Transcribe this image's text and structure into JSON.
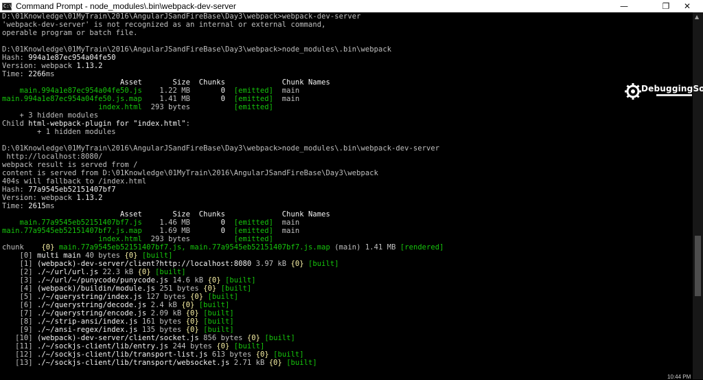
{
  "window": {
    "title": "Command Prompt - node_modules\\.bin\\webpack-dev-server",
    "icon_label": "C:\\",
    "controls": {
      "minimize": "—",
      "maximize": "❐",
      "close": "✕"
    }
  },
  "colors": {
    "background": "#000000",
    "text": "#c0c0c0",
    "green": "#16c60c",
    "yellow": "#f9f1a5",
    "white": "#f2f2f2"
  },
  "console": {
    "lines": [
      [
        {
          "t": "D:\\01Knowledge\\01MyTrain\\2016\\AngularJSandFireBase\\Day3\\webpack>webpack-dev-server",
          "c": ""
        }
      ],
      [
        {
          "t": "'webpack-dev-server' is not recognized as an internal or external command,",
          "c": ""
        }
      ],
      [
        {
          "t": "operable program or batch file.",
          "c": ""
        }
      ],
      [
        {
          "t": "",
          "c": ""
        }
      ],
      [
        {
          "t": "D:\\01Knowledge\\01MyTrain\\2016\\AngularJSandFireBase\\Day3\\webpack>node_modules\\.bin\\webpack",
          "c": ""
        }
      ],
      [
        {
          "t": "Hash: ",
          "c": ""
        },
        {
          "t": "994a1e87ec954a04fe50",
          "c": "w"
        }
      ],
      [
        {
          "t": "Version: webpack ",
          "c": ""
        },
        {
          "t": "1.13.2",
          "c": "w"
        }
      ],
      [
        {
          "t": "Time: ",
          "c": ""
        },
        {
          "t": "2266",
          "c": "w"
        },
        {
          "t": "ms",
          "c": ""
        }
      ],
      [
        {
          "t": "                           Asset       Size  Chunks             Chunk Names",
          "c": "w"
        }
      ],
      [
        {
          "t": "    main.994a1e87ec954a04fe50.js",
          "c": "g"
        },
        {
          "t": "    1.22 MB       ",
          "c": ""
        },
        {
          "t": "0",
          "c": "w"
        },
        {
          "t": "  ",
          "c": ""
        },
        {
          "t": "[emitted]",
          "c": "g"
        },
        {
          "t": "  main",
          "c": ""
        }
      ],
      [
        {
          "t": "main.994a1e87ec954a04fe50.js.map",
          "c": "g"
        },
        {
          "t": "    1.41 MB       ",
          "c": ""
        },
        {
          "t": "0",
          "c": "w"
        },
        {
          "t": "  ",
          "c": ""
        },
        {
          "t": "[emitted]",
          "c": "g"
        },
        {
          "t": "  main",
          "c": ""
        }
      ],
      [
        {
          "t": "                      index.html",
          "c": "g"
        },
        {
          "t": "  293 bytes          ",
          "c": ""
        },
        {
          "t": "[emitted]",
          "c": "g"
        }
      ],
      [
        {
          "t": "    + 3 hidden modules",
          "c": ""
        }
      ],
      [
        {
          "t": "Child ",
          "c": ""
        },
        {
          "t": "html-webpack-plugin for \"index.html\"",
          "c": "w"
        },
        {
          "t": ":",
          "c": ""
        }
      ],
      [
        {
          "t": "        + 1 hidden modules",
          "c": ""
        }
      ],
      [
        {
          "t": "",
          "c": ""
        }
      ],
      [
        {
          "t": "D:\\01Knowledge\\01MyTrain\\2016\\AngularJSandFireBase\\Day3\\webpack>node_modules\\.bin\\webpack-dev-server",
          "c": ""
        }
      ],
      [
        {
          "t": " http://localhost:8080/",
          "c": ""
        }
      ],
      [
        {
          "t": "webpack result is served from /",
          "c": ""
        }
      ],
      [
        {
          "t": "content is served from D:\\01Knowledge\\01MyTrain\\2016\\AngularJSandFireBase\\Day3\\webpack",
          "c": ""
        }
      ],
      [
        {
          "t": "404s will fallback to /index.html",
          "c": ""
        }
      ],
      [
        {
          "t": "Hash: ",
          "c": ""
        },
        {
          "t": "77a9545eb52151407bf7",
          "c": "w"
        }
      ],
      [
        {
          "t": "Version: webpack ",
          "c": ""
        },
        {
          "t": "1.13.2",
          "c": "w"
        }
      ],
      [
        {
          "t": "Time: ",
          "c": ""
        },
        {
          "t": "2615",
          "c": "w"
        },
        {
          "t": "ms",
          "c": ""
        }
      ],
      [
        {
          "t": "                           Asset       Size  Chunks             Chunk Names",
          "c": "w"
        }
      ],
      [
        {
          "t": "    main.77a9545eb52151407bf7.js",
          "c": "g"
        },
        {
          "t": "    1.46 MB       ",
          "c": ""
        },
        {
          "t": "0",
          "c": "w"
        },
        {
          "t": "  ",
          "c": ""
        },
        {
          "t": "[emitted]",
          "c": "g"
        },
        {
          "t": "  main",
          "c": ""
        }
      ],
      [
        {
          "t": "main.77a9545eb52151407bf7.js.map",
          "c": "g"
        },
        {
          "t": "    1.69 MB       ",
          "c": ""
        },
        {
          "t": "0",
          "c": "w"
        },
        {
          "t": "  ",
          "c": ""
        },
        {
          "t": "[emitted]",
          "c": "g"
        },
        {
          "t": "  main",
          "c": ""
        }
      ],
      [
        {
          "t": "                      index.html",
          "c": "g"
        },
        {
          "t": "  293 bytes          ",
          "c": ""
        },
        {
          "t": "[emitted]",
          "c": "g"
        }
      ],
      [
        {
          "t": "chunk    ",
          "c": ""
        },
        {
          "t": "{0}",
          "c": "y"
        },
        {
          "t": " main.77a9545eb52151407bf7.js, main.77a9545eb52151407bf7.js.map",
          "c": "g"
        },
        {
          "t": " (main) 1.41 MB ",
          "c": ""
        },
        {
          "t": "[rendered]",
          "c": "g"
        }
      ],
      [
        {
          "t": "    [0] ",
          "c": ""
        },
        {
          "t": "multi main",
          "c": "w"
        },
        {
          "t": " 40 bytes ",
          "c": ""
        },
        {
          "t": "{0}",
          "c": "y"
        },
        {
          "t": " ",
          "c": ""
        },
        {
          "t": "[built]",
          "c": "g"
        }
      ],
      [
        {
          "t": "    [1] ",
          "c": ""
        },
        {
          "t": "(webpack)-dev-server/client?http://localhost:8080",
          "c": "w"
        },
        {
          "t": " 3.97 kB ",
          "c": ""
        },
        {
          "t": "{0}",
          "c": "y"
        },
        {
          "t": " ",
          "c": ""
        },
        {
          "t": "[built]",
          "c": "g"
        }
      ],
      [
        {
          "t": "    [2] ",
          "c": ""
        },
        {
          "t": "./~/url/url.js",
          "c": "w"
        },
        {
          "t": " 22.3 kB ",
          "c": ""
        },
        {
          "t": "{0}",
          "c": "y"
        },
        {
          "t": " ",
          "c": ""
        },
        {
          "t": "[built]",
          "c": "g"
        }
      ],
      [
        {
          "t": "    [3] ",
          "c": ""
        },
        {
          "t": "./~/url/~/punycode/punycode.js",
          "c": "w"
        },
        {
          "t": " 14.6 kB ",
          "c": ""
        },
        {
          "t": "{0}",
          "c": "y"
        },
        {
          "t": " ",
          "c": ""
        },
        {
          "t": "[built]",
          "c": "g"
        }
      ],
      [
        {
          "t": "    [4] ",
          "c": ""
        },
        {
          "t": "(webpack)/buildin/module.js",
          "c": "w"
        },
        {
          "t": " 251 bytes ",
          "c": ""
        },
        {
          "t": "{0}",
          "c": "y"
        },
        {
          "t": " ",
          "c": ""
        },
        {
          "t": "[built]",
          "c": "g"
        }
      ],
      [
        {
          "t": "    [5] ",
          "c": ""
        },
        {
          "t": "./~/querystring/index.js",
          "c": "w"
        },
        {
          "t": " 127 bytes ",
          "c": ""
        },
        {
          "t": "{0}",
          "c": "y"
        },
        {
          "t": " ",
          "c": ""
        },
        {
          "t": "[built]",
          "c": "g"
        }
      ],
      [
        {
          "t": "    [6] ",
          "c": ""
        },
        {
          "t": "./~/querystring/decode.js",
          "c": "w"
        },
        {
          "t": " 2.4 kB ",
          "c": ""
        },
        {
          "t": "{0}",
          "c": "y"
        },
        {
          "t": " ",
          "c": ""
        },
        {
          "t": "[built]",
          "c": "g"
        }
      ],
      [
        {
          "t": "    [7] ",
          "c": ""
        },
        {
          "t": "./~/querystring/encode.js",
          "c": "w"
        },
        {
          "t": " 2.09 kB ",
          "c": ""
        },
        {
          "t": "{0}",
          "c": "y"
        },
        {
          "t": " ",
          "c": ""
        },
        {
          "t": "[built]",
          "c": "g"
        }
      ],
      [
        {
          "t": "    [8] ",
          "c": ""
        },
        {
          "t": "./~/strip-ansi/index.js",
          "c": "w"
        },
        {
          "t": " 161 bytes ",
          "c": ""
        },
        {
          "t": "{0}",
          "c": "y"
        },
        {
          "t": " ",
          "c": ""
        },
        {
          "t": "[built]",
          "c": "g"
        }
      ],
      [
        {
          "t": "    [9] ",
          "c": ""
        },
        {
          "t": "./~/ansi-regex/index.js",
          "c": "w"
        },
        {
          "t": " 135 bytes ",
          "c": ""
        },
        {
          "t": "{0}",
          "c": "y"
        },
        {
          "t": " ",
          "c": ""
        },
        {
          "t": "[built]",
          "c": "g"
        }
      ],
      [
        {
          "t": "   [10] ",
          "c": ""
        },
        {
          "t": "(webpack)-dev-server/client/socket.js",
          "c": "w"
        },
        {
          "t": " 856 bytes ",
          "c": ""
        },
        {
          "t": "{0}",
          "c": "y"
        },
        {
          "t": " ",
          "c": ""
        },
        {
          "t": "[built]",
          "c": "g"
        }
      ],
      [
        {
          "t": "   [11] ",
          "c": ""
        },
        {
          "t": "./~/sockjs-client/lib/entry.js",
          "c": "w"
        },
        {
          "t": " 244 bytes ",
          "c": ""
        },
        {
          "t": "{0}",
          "c": "y"
        },
        {
          "t": " ",
          "c": ""
        },
        {
          "t": "[built]",
          "c": "g"
        }
      ],
      [
        {
          "t": "   [12] ",
          "c": ""
        },
        {
          "t": "./~/sockjs-client/lib/transport-list.js",
          "c": "w"
        },
        {
          "t": " 613 bytes ",
          "c": ""
        },
        {
          "t": "{0}",
          "c": "y"
        },
        {
          "t": " ",
          "c": ""
        },
        {
          "t": "[built]",
          "c": "g"
        }
      ],
      [
        {
          "t": "   [13] ",
          "c": ""
        },
        {
          "t": "./~/sockjs-client/lib/transport/websocket.js",
          "c": "w"
        },
        {
          "t": " 2.71 kB ",
          "c": ""
        },
        {
          "t": "{0}",
          "c": "y"
        },
        {
          "t": " ",
          "c": ""
        },
        {
          "t": "[built]",
          "c": "g"
        }
      ]
    ]
  },
  "overlay": {
    "logo_text": "DebuggingSoft",
    "clock": "10:44 PM"
  }
}
